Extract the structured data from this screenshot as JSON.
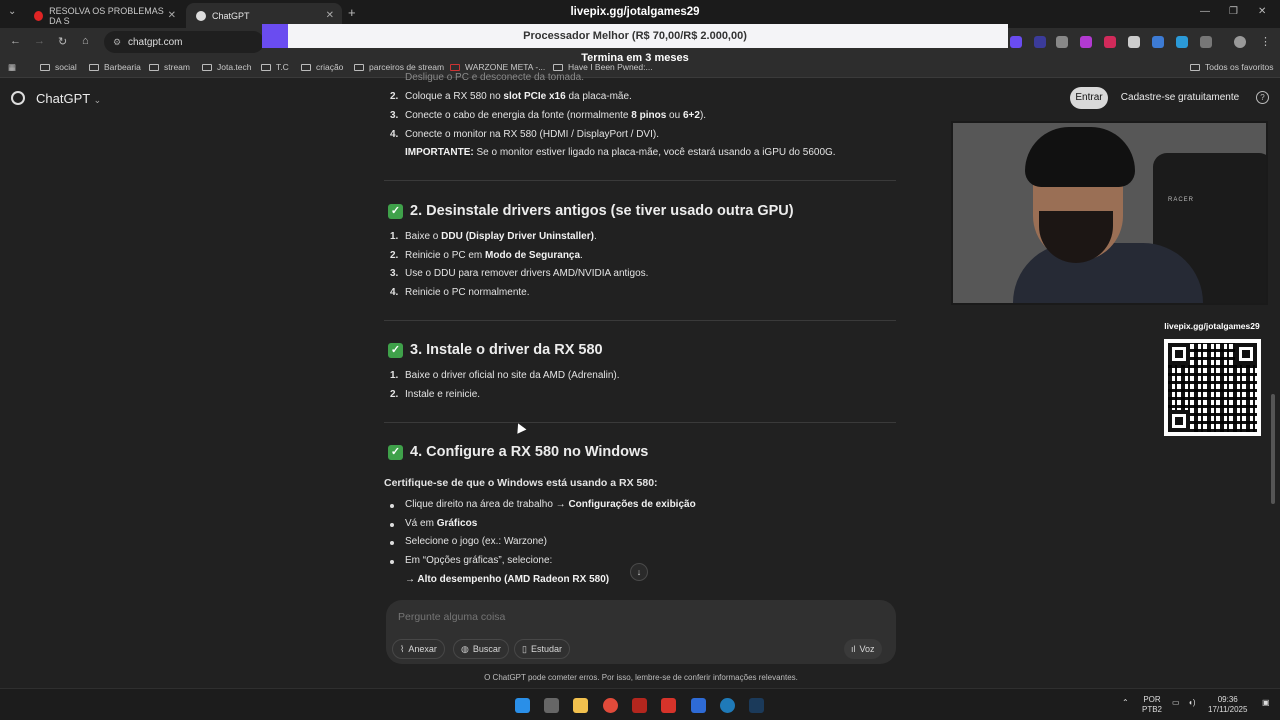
{
  "browser": {
    "tabs": [
      {
        "title": "RESOLVA OS PROBLEMAS DA S",
        "favicon_color": "#e02424"
      },
      {
        "title": "ChatGPT",
        "favicon_color": "#dddddd",
        "active": true
      }
    ],
    "url": "chatgpt.com",
    "bookmarks": [
      "social",
      "Barbearia",
      "stream",
      "Jota.tech",
      "T.C",
      "criação",
      "parceiros de stream",
      "WARZONE META -...",
      "Have I Been Pwned:...",
      "Todos os favoritos"
    ]
  },
  "overlay": {
    "url": "livepix.gg/jotalgames29",
    "goal_label": "Processador Melhor (R$ 70,00/R$ 2.000,00)",
    "goal_progress": 0.035,
    "goal_fill_color": "#6a4cf0",
    "sub_label": "Termina em 3 meses",
    "qr_label": "livepix.gg/jotalgames29",
    "webcam_brand": "RACER"
  },
  "app": {
    "title": "ChatGPT",
    "login_label": "Entrar",
    "signup_label": "Cadastre-se gratuitamente",
    "help_icon": "?"
  },
  "content": {
    "cut_line": "Desligue o PC e desconecte da tomada.",
    "step1": [
      {
        "n": "2.",
        "pre": "Coloque a RX 580 no ",
        "bold": "slot PCIe x16",
        "post": " da placa-mãe."
      },
      {
        "n": "3.",
        "pre": "Conecte o cabo de energia da fonte (normalmente ",
        "bold": "8 pinos",
        "mid": " ou ",
        "bold2": "6+2",
        "post": ")."
      },
      {
        "n": "4.",
        "pre": "Conecte o monitor na RX 580 (HDMI / DisplayPort / DVI).",
        "bold": "",
        "post": ""
      }
    ],
    "important_bold": "IMPORTANTE:",
    "important_text": " Se o monitor estiver ligado na placa-mãe, você estará usando a iGPU do 5600G.",
    "h2": "2. Desinstale drivers antigos (se tiver usado outra GPU)",
    "step2": [
      {
        "n": "1.",
        "pre": "Baixe o ",
        "bold": "DDU (Display Driver Uninstaller)",
        "post": "."
      },
      {
        "n": "2.",
        "pre": "Reinicie o PC em ",
        "bold": "Modo de Segurança",
        "post": "."
      },
      {
        "n": "3.",
        "pre": "Use o DDU para remover drivers AMD/NVIDIA antigos.",
        "bold": "",
        "post": ""
      },
      {
        "n": "4.",
        "pre": "Reinicie o PC normalmente.",
        "bold": "",
        "post": ""
      }
    ],
    "h3": "3. Instale o driver da RX 580",
    "step3": [
      {
        "n": "1.",
        "pre": "Baixe o driver oficial no site da AMD (Adrenalin).",
        "bold": "",
        "post": ""
      },
      {
        "n": "2.",
        "pre": "Instale e reinicie.",
        "bold": "",
        "post": ""
      }
    ],
    "h4": "4. Configure a RX 580 no Windows",
    "lead": "Certifique-se de que o Windows está usando a RX 580:",
    "step4": [
      {
        "pre": "Clique direito na área de trabalho → ",
        "bold": "Configurações de exibição",
        "post": ""
      },
      {
        "pre": "Vá em ",
        "bold": "Gráficos",
        "post": ""
      },
      {
        "pre": "Selecione o jogo (ex.: Warzone)",
        "bold": "",
        "post": ""
      },
      {
        "pre": "Em “Opções gráficas”, selecione:",
        "bold": "",
        "post": ""
      }
    ],
    "final_line": "→ Alto desempenho (AMD Radeon RX 580)"
  },
  "composer": {
    "placeholder": "Pergunte alguma coisa",
    "attach": "Anexar",
    "search": "Buscar",
    "study": "Estudar",
    "voice": "Voz"
  },
  "disclaimer": "O ChatGPT pode cometer erros. Por isso, lembre-se de conferir informações relevantes.",
  "taskbar": {
    "lang": "POR",
    "layout": "PTB2",
    "time": "09:36",
    "date": "17/11/2025"
  }
}
